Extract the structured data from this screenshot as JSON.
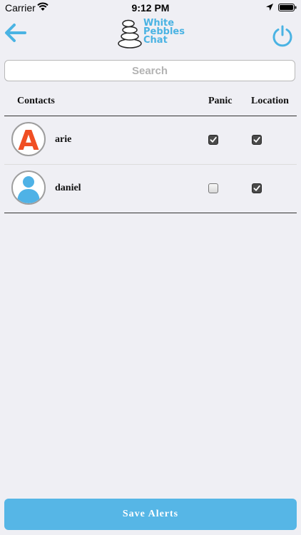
{
  "status_bar": {
    "carrier": "Carrier",
    "time": "9:12 PM"
  },
  "header": {
    "brand": [
      "White",
      "Pebbles",
      "Chat"
    ]
  },
  "search": {
    "placeholder": "Search"
  },
  "table": {
    "columns": [
      "Contacts",
      "Panic",
      "Location"
    ],
    "rows": [
      {
        "name": "arie",
        "avatar_letter": "A",
        "panic": true,
        "location": true
      },
      {
        "name": "daniel",
        "avatar_letter": "",
        "panic": false,
        "location": true
      }
    ]
  },
  "actions": {
    "save_label": "Save Alerts"
  },
  "colors": {
    "accent": "#56b6e6",
    "logo_text": "#4ab3e3",
    "avatar_letter": "#f04e23"
  }
}
